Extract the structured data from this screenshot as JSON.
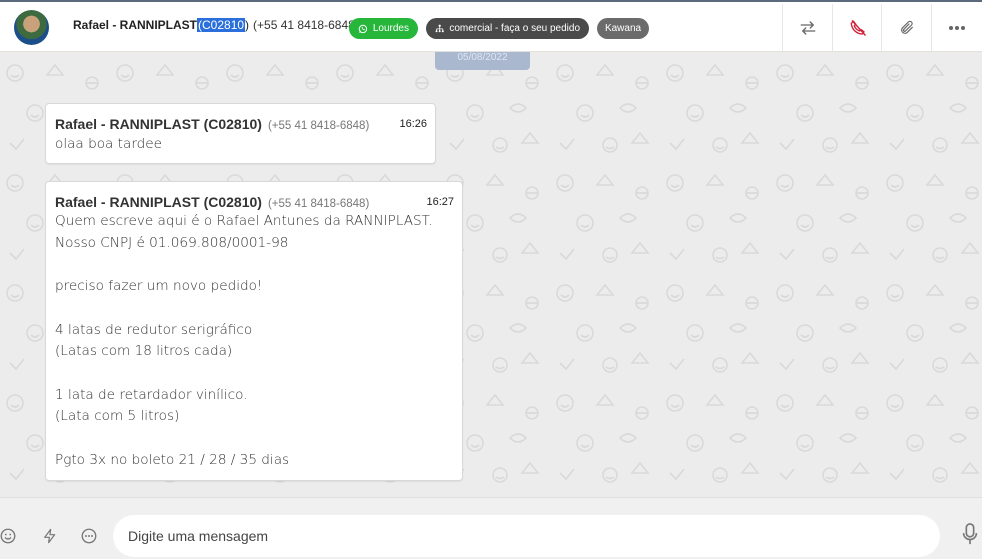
{
  "header": {
    "contact_name": "Rafael - RANNIPLAST ",
    "contact_code": "(C02810",
    "contact_code_close": ")",
    "contact_phone": "(+55 41 8418-6848)",
    "tags": {
      "whatsapp": "Lourdes",
      "department": "comercial - faça o seu pedido",
      "agent": "Kawana"
    },
    "icons": [
      "transfer-icon",
      "hangup-phone-icon",
      "paperclip-icon",
      "more-icon"
    ]
  },
  "date_chip": "05/08/2022",
  "messages": [
    {
      "sender": "Rafael - RANNIPLAST (C02810)",
      "phone": "(+55 41 8418-6848)",
      "time": "16:26",
      "text": "olaa boa tardee"
    },
    {
      "sender": "Rafael - RANNIPLAST (C02810)",
      "phone": "(+55 41 8418-6848)",
      "time": "16:27",
      "text": "Quem escreve aqui é o Rafael Antunes da RANNIPLAST.\nNosso CNPJ é 01.069.808/0001-98\n\npreciso fazer um novo pedido!\n\n4 latas de redutor serigráfico\n(Latas com 18 litros cada)\n\n1 lata de retardador vinílico.\n(Lata com 5 litros)\n\nPgto 3x no boleto 21 / 28 / 35 dias"
    }
  ],
  "composer": {
    "placeholder": "Digite uma mensagem",
    "value": ""
  },
  "colors": {
    "whatsapp_tag": "#25b63a",
    "department_tag": "#4a4a4a",
    "agent_tag": "#6b6b6b",
    "selection": "#2a6fdb",
    "hangup_icon": "#d0213a"
  }
}
